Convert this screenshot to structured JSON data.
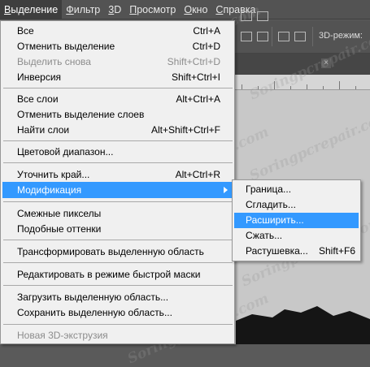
{
  "menubar": {
    "items": [
      {
        "u": "В",
        "rest": "ыделение"
      },
      {
        "u": "Ф",
        "rest": "ильтр"
      },
      {
        "u": "3",
        "rest": "D"
      },
      {
        "u": "П",
        "rest": "росмотр"
      },
      {
        "u": "О",
        "rest": "кно"
      },
      {
        "u": "С",
        "rest": "правка"
      }
    ]
  },
  "optionsbar": {
    "mode_label": "3D-режим:"
  },
  "menu": {
    "all": {
      "label": "Все",
      "shortcut": "Ctrl+A"
    },
    "deselect": {
      "label": "Отменить выделение",
      "shortcut": "Ctrl+D"
    },
    "reselect": {
      "label": "Выделить снова",
      "shortcut": "Shift+Ctrl+D"
    },
    "inverse": {
      "label": "Инверсия",
      "shortcut": "Shift+Ctrl+I"
    },
    "all_layers": {
      "label": "Все слои",
      "shortcut": "Alt+Ctrl+A"
    },
    "deselect_layers": {
      "label": "Отменить выделение слоев",
      "shortcut": ""
    },
    "find_layers": {
      "label": "Найти слои",
      "shortcut": "Alt+Shift+Ctrl+F"
    },
    "color_range": {
      "label": "Цветовой диапазон...",
      "shortcut": ""
    },
    "refine_edge": {
      "label": "Уточнить край...",
      "shortcut": "Alt+Ctrl+R"
    },
    "modify": {
      "label": "Модификация",
      "shortcut": ""
    },
    "grow": {
      "label": "Смежные пикселы",
      "shortcut": ""
    },
    "similar": {
      "label": "Подобные оттенки",
      "shortcut": ""
    },
    "transform": {
      "label": "Трансформировать выделенную область",
      "shortcut": ""
    },
    "quick_mask": {
      "label": "Редактировать в режиме быстрой маски",
      "shortcut": ""
    },
    "load": {
      "label": "Загрузить выделенную область...",
      "shortcut": ""
    },
    "save": {
      "label": "Сохранить выделенную область...",
      "shortcut": ""
    },
    "new_3d": {
      "label": "Новая 3D-экструзия",
      "shortcut": ""
    }
  },
  "submenu": {
    "border": {
      "label": "Граница...",
      "shortcut": ""
    },
    "smooth": {
      "label": "Сгладить...",
      "shortcut": ""
    },
    "expand": {
      "label": "Расширить...",
      "shortcut": ""
    },
    "contract": {
      "label": "Сжать...",
      "shortcut": ""
    },
    "feather": {
      "label": "Растушевка...",
      "shortcut": "Shift+F6"
    }
  },
  "colors": {
    "highlight": "#3399ff",
    "menu_bg": "#f0f0f0",
    "app_bg": "#535353",
    "canvas": "#c8c8c8"
  }
}
